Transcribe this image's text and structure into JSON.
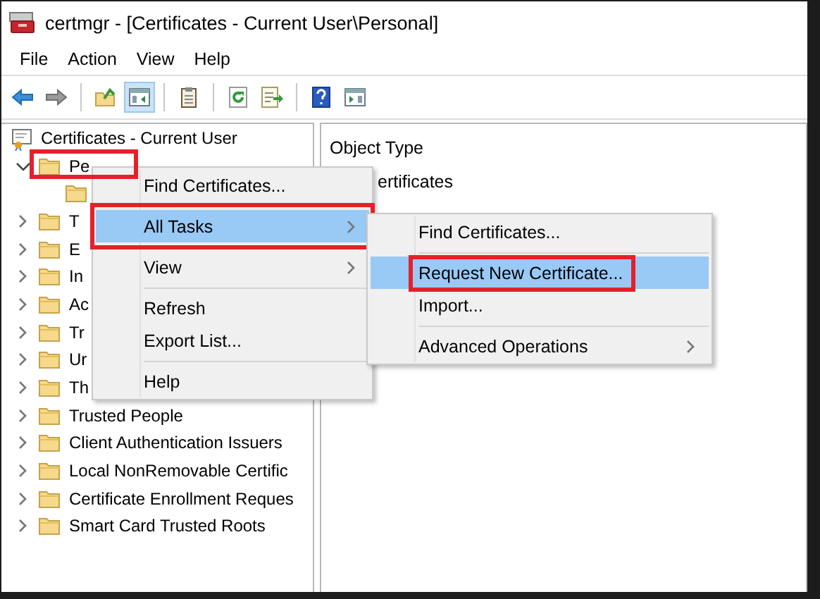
{
  "window": {
    "title": "certmgr - [Certificates - Current User\\Personal]"
  },
  "menu_bar": [
    {
      "label": "File"
    },
    {
      "label": "Action"
    },
    {
      "label": "View"
    },
    {
      "label": "Help"
    }
  ],
  "toolbar": [
    {
      "kind": "back",
      "pressed": false
    },
    {
      "kind": "forward",
      "pressed": false
    },
    {
      "kind": "separator"
    },
    {
      "kind": "up",
      "pressed": false
    },
    {
      "kind": "tree",
      "pressed": true
    },
    {
      "kind": "separator"
    },
    {
      "kind": "clipboard",
      "pressed": false
    },
    {
      "kind": "separator"
    },
    {
      "kind": "refresh",
      "pressed": false
    },
    {
      "kind": "export",
      "pressed": false
    },
    {
      "kind": "separator"
    },
    {
      "kind": "help",
      "pressed": false
    },
    {
      "kind": "pane",
      "pressed": false
    }
  ],
  "tree": {
    "label": "Certificates - Current User",
    "children": [
      {
        "label": "Pe",
        "expanded": true,
        "highlighted": true,
        "children": [
          {
            "kind": "folder"
          }
        ]
      },
      {
        "label": "T",
        "expanded": false,
        "highlighted": false
      },
      {
        "label": "E",
        "expanded": false,
        "highlighted": false
      },
      {
        "label": "In",
        "expanded": false,
        "highlighted": false
      },
      {
        "label": "Ac",
        "expanded": false,
        "highlighted": false
      },
      {
        "label": "Tr",
        "expanded": false,
        "highlighted": false
      },
      {
        "label": "Ur",
        "expanded": false,
        "highlighted": false
      },
      {
        "label": "Th",
        "expanded": false,
        "highlighted": false
      },
      {
        "label": "Trusted People",
        "expanded": false,
        "highlighted": false
      },
      {
        "label": "Client Authentication Issuers",
        "expanded": false,
        "highlighted": false
      },
      {
        "label": "Local NonRemovable Certific",
        "expanded": false,
        "highlighted": false
      },
      {
        "label": "Certificate Enrollment Reques",
        "expanded": false,
        "highlighted": false
      },
      {
        "label": "Smart Card Trusted Roots",
        "expanded": false,
        "highlighted": false
      }
    ]
  },
  "content": {
    "columns": [
      "Object Type"
    ],
    "rows": [
      "ertificates"
    ]
  },
  "context_menu": [
    {
      "kind": "item",
      "label": "Find Certificates...",
      "selected": false,
      "submenu": false,
      "highlighted": false
    },
    {
      "kind": "separator"
    },
    {
      "kind": "item",
      "label": "All Tasks",
      "selected": true,
      "submenu": true,
      "highlighted": true
    },
    {
      "kind": "separator"
    },
    {
      "kind": "item",
      "label": "View",
      "selected": false,
      "submenu": true,
      "highlighted": false
    },
    {
      "kind": "separator"
    },
    {
      "kind": "item",
      "label": "Refresh",
      "selected": false,
      "submenu": false,
      "highlighted": false
    },
    {
      "kind": "item",
      "label": "Export List...",
      "selected": false,
      "submenu": false,
      "highlighted": false
    },
    {
      "kind": "separator"
    },
    {
      "kind": "item",
      "label": "Help",
      "selected": false,
      "submenu": false,
      "highlighted": false
    }
  ],
  "submenu": [
    {
      "kind": "item",
      "label": "Find Certificates...",
      "selected": false,
      "submenu": false,
      "highlighted": false
    },
    {
      "kind": "separator"
    },
    {
      "kind": "item",
      "label": "Request New Certificate...",
      "selected": true,
      "submenu": false,
      "highlighted": true
    },
    {
      "kind": "item",
      "label": "Import...",
      "selected": false,
      "submenu": false,
      "highlighted": false
    },
    {
      "kind": "separator"
    },
    {
      "kind": "item",
      "label": "Advanced Operations",
      "selected": false,
      "submenu": true,
      "highlighted": false
    }
  ]
}
